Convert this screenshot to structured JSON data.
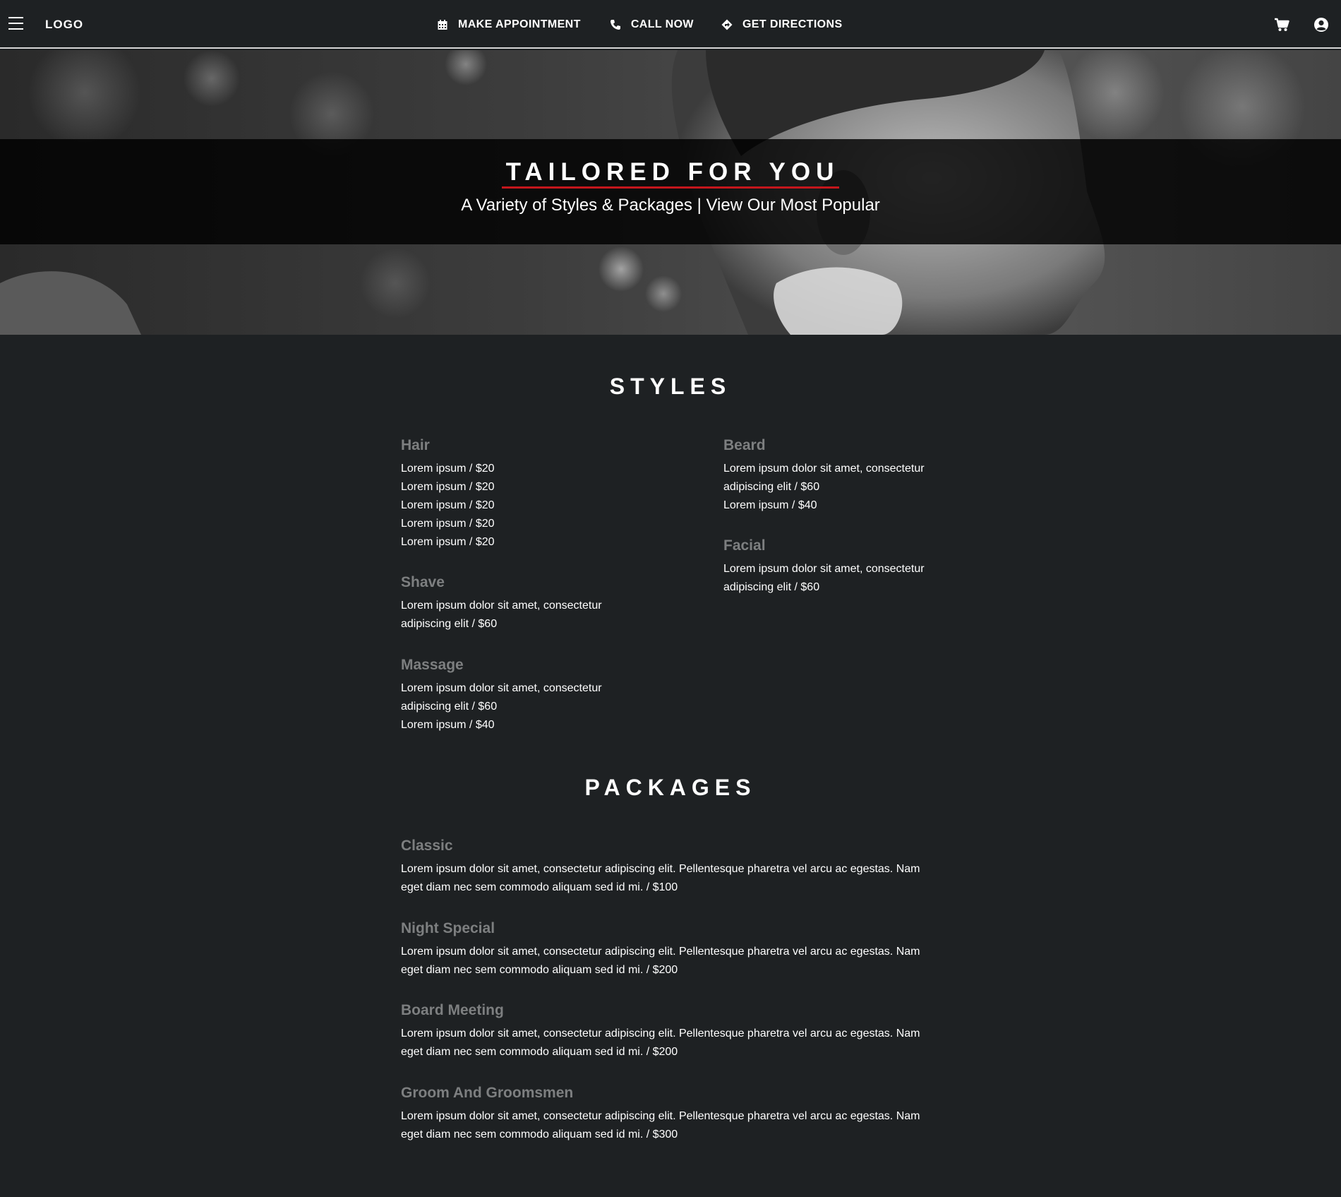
{
  "nav": {
    "logo": "LOGO",
    "links": [
      {
        "label": "MAKE APPOINTMENT",
        "icon": "calendar-icon"
      },
      {
        "label": "CALL NOW",
        "icon": "phone-icon"
      },
      {
        "label": "GET DIRECTIONS",
        "icon": "directions-icon"
      }
    ],
    "right_icons": [
      "cart-icon",
      "user-account-icon"
    ]
  },
  "hero": {
    "title": "TAILORED FOR YOU",
    "subtitle": "A Variety of Styles & Packages | View Our Most Popular",
    "accent_color": "#c4161c"
  },
  "styles": {
    "title": "STYLES",
    "hair": {
      "name": "Hair",
      "lines": [
        "Lorem ipsum / $20",
        "Lorem ipsum / $20",
        "Lorem ipsum / $20",
        "Lorem ipsum / $20",
        "Lorem ipsum / $20"
      ]
    },
    "shave": {
      "name": "Shave",
      "lines": [
        "Lorem ipsum dolor sit amet, consectetur",
        "adipiscing elit / $60"
      ]
    },
    "massage": {
      "name": "Massage",
      "lines": [
        "Lorem ipsum dolor sit amet, consectetur",
        "adipiscing elit / $60",
        "Lorem ipsum / $40"
      ]
    },
    "beard": {
      "name": "Beard",
      "lines": [
        "Lorem ipsum dolor sit amet, consectetur",
        "adipiscing elit / $60",
        "Lorem ipsum / $40"
      ]
    },
    "facial": {
      "name": "Facial",
      "lines": [
        "Lorem ipsum dolor sit amet, consectetur",
        "adipiscing elit / $60"
      ]
    }
  },
  "packages": {
    "title": "PACKAGES",
    "items": [
      {
        "name": "Classic",
        "line1": "Lorem ipsum dolor sit amet, consectetur adipiscing elit. Pellentesque pharetra vel arcu ac egestas. Nam",
        "line2": "eget diam nec sem commodo aliquam sed id mi. / $100"
      },
      {
        "name": "Night Special",
        "line1": "Lorem ipsum dolor sit amet, consectetur adipiscing elit. Pellentesque pharetra vel arcu ac egestas. Nam",
        "line2": "eget diam nec sem commodo aliquam sed id mi. / $200"
      },
      {
        "name": "Board Meeting",
        "line1": "Lorem ipsum dolor sit amet, consectetur adipiscing elit. Pellentesque pharetra vel arcu ac egestas. Nam",
        "line2": "eget diam nec sem commodo aliquam sed id mi. / $200"
      },
      {
        "name": "Groom And Groomsmen",
        "line1": "Lorem ipsum dolor sit amet, consectetur adipiscing elit. Pellentesque pharetra vel arcu ac egestas. Nam",
        "line2": "eget diam nec sem commodo aliquam sed id mi. / $300"
      }
    ]
  },
  "colors": {
    "background": "#1e2123",
    "category_heading": "#7d7f80",
    "text": "#ffffff"
  }
}
